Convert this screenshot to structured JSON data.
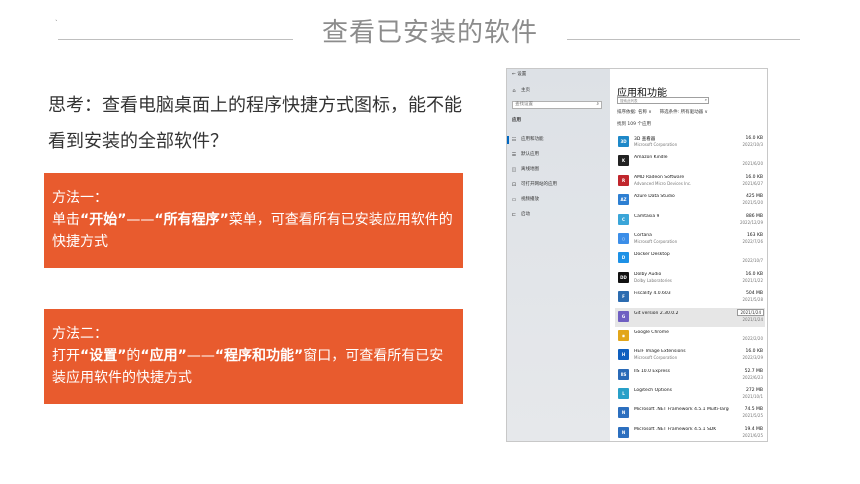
{
  "slide": {
    "title": "查看已安装的软件",
    "mark": "`",
    "question": "思考：查看电脑桌面上的程序快捷方式图标，能不能看到安装的全部软件？",
    "method1": {
      "heading": "方法一：",
      "p1": "单击",
      "k1": "“开始”",
      "p2": "——",
      "k2": "“所有程序”",
      "p3": "菜单，可查看所有已安装应用软件的快捷方式"
    },
    "method2": {
      "heading": "方法二：",
      "p1": "打开",
      "k1": "“设置”",
      "p2": "的",
      "k2": "“应用”",
      "p3": "——",
      "k3": "“程序和功能”",
      "p4": "窗口，可查看所有已安装应用软件的快捷方式"
    }
  },
  "settings": {
    "back_label": "←  设置",
    "home": "主页",
    "search_placeholder": "查找设置",
    "section": "应用",
    "nav": [
      {
        "icon": "apps-icon",
        "glyph": "☷",
        "label": "应用和功能",
        "selected": true
      },
      {
        "icon": "default-apps-icon",
        "glyph": "☰",
        "label": "默认应用",
        "selected": false
      },
      {
        "icon": "offline-maps-icon",
        "glyph": "◫",
        "label": "离线地图",
        "selected": false
      },
      {
        "icon": "websites-icon",
        "glyph": "⊡",
        "label": "可打开网站的应用",
        "selected": false
      },
      {
        "icon": "video-icon",
        "glyph": "▭",
        "label": "视频播放",
        "selected": false
      },
      {
        "icon": "startup-icon",
        "glyph": "⊏",
        "label": "启动",
        "selected": false
      }
    ],
    "main_title": "应用和功能",
    "list_search_placeholder": "搜索此列表",
    "sort_label": "排序依据: 名称 ∨",
    "filter_label": "筛选条件: 所有驱动器 ∨",
    "found": "找到 109 个应用",
    "tooltip": "2021/1/24",
    "apps": [
      {
        "name": "3D 查看器",
        "publisher": "Microsoft Corporation",
        "size": "16.0 KB",
        "date": "2022/10/3",
        "color": "#1e88c8",
        "glyph": "3D"
      },
      {
        "name": "Amazon Kindle",
        "publisher": "",
        "size": "",
        "date": "2021/6/20",
        "color": "#222222",
        "glyph": "K"
      },
      {
        "name": "AMD Radeon Software",
        "publisher": "Advanced Micro Devices Inc.",
        "size": "16.0 KB",
        "date": "2021/6/27",
        "color": "#c0262d",
        "glyph": "R"
      },
      {
        "name": "Azure Data Studio",
        "publisher": "",
        "size": "425 MB",
        "date": "2021/5/20",
        "color": "#2d7fd2",
        "glyph": "AZ"
      },
      {
        "name": "Camtasia 9",
        "publisher": "",
        "size": "886 MB",
        "date": "2022/12/29",
        "color": "#3aa5d8",
        "glyph": "C"
      },
      {
        "name": "Cortana",
        "publisher": "Microsoft Corporation",
        "size": "163 KB",
        "date": "2022/7/26",
        "color": "#3b8ee8",
        "glyph": "○"
      },
      {
        "name": "Docker Desktop",
        "publisher": "",
        "size": "",
        "date": "2022/10/7",
        "color": "#1d91e6",
        "glyph": "D"
      },
      {
        "name": "Dolby Audio",
        "publisher": "Dolby Laboratories",
        "size": "16.0 KB",
        "date": "2021/1/22",
        "color": "#111111",
        "glyph": "DD"
      },
      {
        "name": "Fiscality 4.0.603",
        "publisher": "",
        "size": "504 MB",
        "date": "2021/5/28",
        "color": "#2c6cb0",
        "glyph": "F"
      },
      {
        "name": "Git version 2.30.0.2",
        "publisher": "",
        "size": "",
        "date": "2021/1/24",
        "color": "#6f5fc2",
        "glyph": "G",
        "selected": true
      },
      {
        "name": "Google Chrome",
        "publisher": "",
        "size": "",
        "date": "2022/2/20",
        "color": "#e2a61b",
        "glyph": "◉"
      },
      {
        "name": "HEIF Image Extensions",
        "publisher": "Microsoft Corporation",
        "size": "16.0 KB",
        "date": "2022/3/29",
        "color": "#0f5fbf",
        "glyph": "H"
      },
      {
        "name": "IIS 10.0 Express",
        "publisher": "",
        "size": "52.7 MB",
        "date": "2022/6/23",
        "color": "#2a6ab7",
        "glyph": "IIS"
      },
      {
        "name": "Logitech Options",
        "publisher": "",
        "size": "272 MB",
        "date": "2021/10/1",
        "color": "#28a0c8",
        "glyph": "L"
      },
      {
        "name": "Microsoft .NET Framework 4.5.1 Multi-Targeting P...",
        "publisher": "",
        "size": "74.5 MB",
        "date": "2021/5/25",
        "color": "#2c6fbf",
        "glyph": "N"
      },
      {
        "name": "Microsoft .NET Framework 4.5.1 SDK",
        "publisher": "",
        "size": "19.4 MB",
        "date": "2021/6/25",
        "color": "#2c6fbf",
        "glyph": "N"
      }
    ]
  }
}
